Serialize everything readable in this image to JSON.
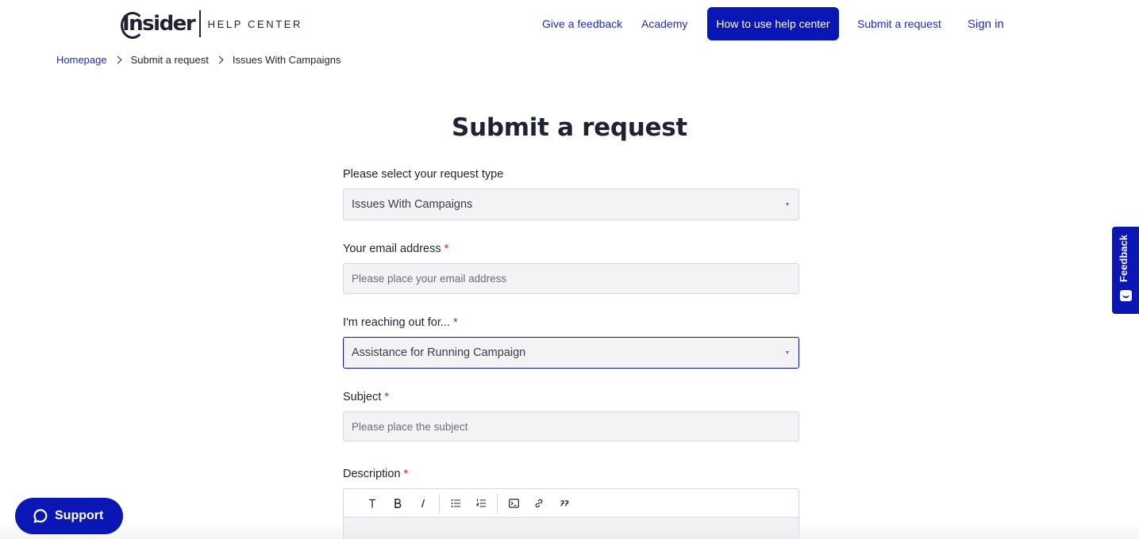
{
  "header": {
    "logo_text": "Insider",
    "logo_subtitle": "HELP CENTER",
    "nav": {
      "feedback": "Give a feedback",
      "academy": "Academy",
      "how_to": "How to use help center",
      "submit": "Submit a request",
      "sign_in": "Sign in"
    }
  },
  "breadcrumb": {
    "home": "Homepage",
    "submit": "Submit a request",
    "current": "Issues With Campaigns"
  },
  "page_title": "Submit a request",
  "form": {
    "request_type": {
      "label": "Please select your request type",
      "value": "Issues With Campaigns"
    },
    "email": {
      "label": "Your email address",
      "required_mark": "*",
      "placeholder": "Please place your email address"
    },
    "reaching_out": {
      "label": "I'm reaching out for...",
      "required_mark": "*",
      "value": "Assistance for Running Campaign"
    },
    "subject": {
      "label": "Subject",
      "required_mark": "*",
      "placeholder": "Please place the subject"
    },
    "description": {
      "label": "Description",
      "required_mark": "*",
      "toolbar": [
        "text-format-icon",
        "bold-icon",
        "italic-icon",
        "bullet-list-icon",
        "numbered-list-icon",
        "code-block-icon",
        "link-icon",
        "quote-icon"
      ]
    }
  },
  "feedback_tab": {
    "label": "Feedback"
  },
  "support_button": {
    "label": "Support"
  },
  "colors": {
    "primary": "#0b17b5",
    "link": "#1d2dba",
    "required": "#d2222d",
    "field_bg": "#f3f3f5"
  }
}
